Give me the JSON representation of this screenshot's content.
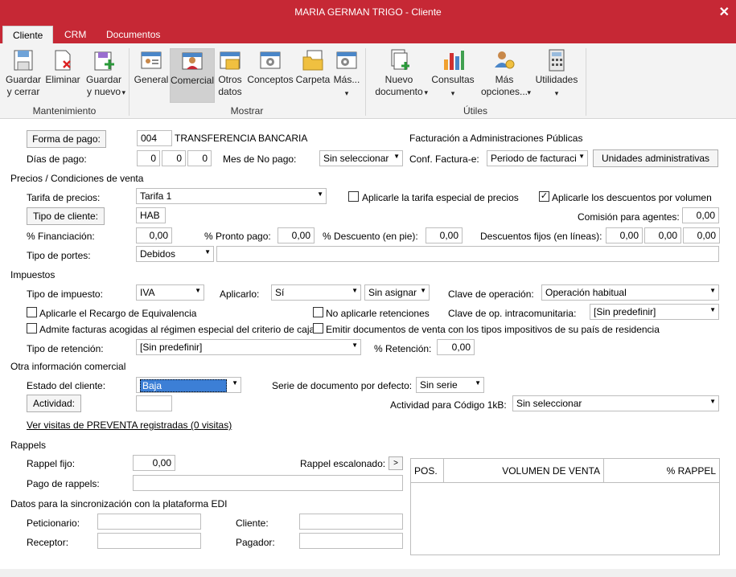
{
  "window": {
    "title": "MARIA GERMAN TRIGO - Cliente",
    "close_glyph": "✕"
  },
  "tabs": [
    {
      "label": "Cliente",
      "active": true
    },
    {
      "label": "CRM",
      "active": false
    },
    {
      "label": "Documentos",
      "active": false
    }
  ],
  "ribbon": {
    "groups": {
      "mantenimiento": "Mantenimiento",
      "mostrar": "Mostrar",
      "utiles": "Útiles"
    },
    "buttons": {
      "guardar_cerrar": "Guardar\ny cerrar",
      "eliminar": "Eliminar",
      "guardar_nuevo": "Guardar\ny nuevo",
      "general": "General",
      "comercial": "Comercial",
      "otros_datos": "Otros\ndatos",
      "conceptos": "Conceptos",
      "carpeta": "Carpeta",
      "mas": "Más...",
      "nuevo_documento": "Nuevo\ndocumento",
      "consultas": "Consultas",
      "mas_opciones": "Más\nopciones...",
      "utilidades": "Utilidades"
    },
    "dropdown_glyph": "▾"
  },
  "form": {
    "forma_pago_btn": "Forma de pago:",
    "forma_pago_code": "004",
    "forma_pago_desc": "TRANSFERENCIA BANCARIA",
    "facturacion_admin": "Facturación a Administraciones Públicas",
    "dias_pago_label": "Días de pago:",
    "dias_pago": [
      "0",
      "0",
      "0"
    ],
    "mes_no_pago_label": "Mes de No pago:",
    "mes_no_pago": "Sin seleccionar",
    "conf_factura_label": "Conf. Factura-e:",
    "conf_factura": "Periodo de facturaci",
    "unidades_btn": "Unidades administrativas",
    "precios_section": "Precios / Condiciones de venta",
    "tarifa_label": "Tarifa de precios:",
    "tarifa": "Tarifa 1",
    "aplicar_tarifa_especial": "Aplicarle la tarifa especial de precios",
    "aplicar_tarifa_especial_checked": false,
    "aplicar_descuentos": "Aplicarle los descuentos por volumen",
    "aplicar_descuentos_checked": true,
    "tipo_cliente_btn": "Tipo de cliente:",
    "tipo_cliente": "HAB",
    "comision_label": "Comisión para agentes:",
    "comision": "0,00",
    "financiacion_label": "% Financiación:",
    "financiacion": "0,00",
    "pronto_pago_label": "% Pronto pago:",
    "pronto_pago": "0,00",
    "descuento_pie_label": "% Descuento (en pie):",
    "descuento_pie": "0,00",
    "descuentos_fijos_label": "Descuentos fijos (en líneas):",
    "descuentos_fijos": [
      "0,00",
      "0,00",
      "0,00"
    ],
    "tipo_portes_label": "Tipo de portes:",
    "tipo_portes": "Debidos",
    "impuestos_section": "Impuestos",
    "tipo_impuesto_label": "Tipo de impuesto:",
    "tipo_impuesto": "IVA",
    "aplicarlo_label": "Aplicarlo:",
    "aplicarlo": "Sí",
    "asignar": "Sin asignar",
    "clave_operacion_label": "Clave de operación:",
    "clave_operacion": "Operación habitual",
    "recargo_equivalencia": "Aplicarle el Recargo de Equivalencia",
    "no_retenciones": "No aplicarle retenciones",
    "clave_intracom_label": "Clave de op. intracomunitaria:",
    "clave_intracom": "[Sin predefinir]",
    "criterio_caja": "Admite facturas acogidas al régimen especial del criterio de caja",
    "emitir_documentos": "Emitir documentos de venta con los tipos impositivos de su país de residencia",
    "tipo_retencion_label": "Tipo de retención:",
    "tipo_retencion": "[Sin predefinir]",
    "retencion_label": "% Retención:",
    "retencion": "0,00",
    "otra_info_section": "Otra información comercial",
    "estado_label": "Estado del cliente:",
    "estado": "Baja",
    "serie_label": "Serie de documento por defecto:",
    "serie": "Sin serie",
    "actividad_btn": "Actividad:",
    "actividad": "",
    "actividad_1kb_label": "Actividad para Código 1kB:",
    "actividad_1kb": "Sin seleccionar",
    "visitas_link": "Ver visitas de PREVENTA registradas (0 visitas)",
    "rappels_section": "Rappels",
    "rappel_fijo_label": "Rappel fijo:",
    "rappel_fijo": "0,00",
    "rappel_escalonado_label": "Rappel escalonado:",
    "rappel_escalonado_btn": ">",
    "pago_rappels_label": "Pago de rappels:",
    "pago_rappels": "",
    "rappel_grid_headers": [
      "POS.",
      "VOLUMEN DE VENTA",
      "% RAPPEL"
    ],
    "edi_section": "Datos para la sincronización con la plataforma EDI",
    "peticionario_label": "Peticionario:",
    "cliente_label": "Cliente:",
    "receptor_label": "Receptor:",
    "pagador_label": "Pagador:"
  },
  "colors": {
    "titlebar": "#c62835",
    "ribbon_bg": "#f3f3f3",
    "selected_row": "#3c7fd6"
  }
}
